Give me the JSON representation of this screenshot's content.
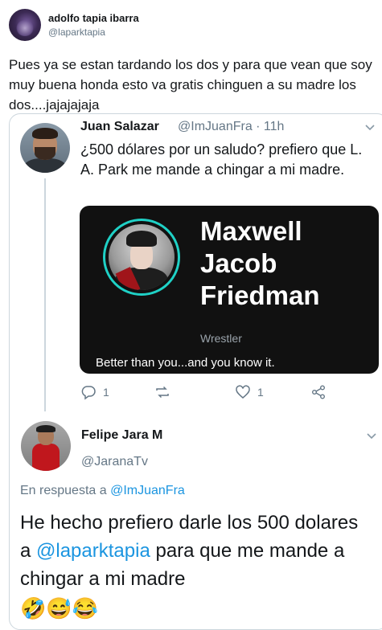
{
  "tweet": {
    "author_name": "adolfo tapia ibarra",
    "author_handle": "@laparktapia",
    "text": "Pues ya se estan tardando los dos y para que vean que soy muy buena honda esto va gratis chinguen a su madre los dos....jajajajaja"
  },
  "quoted": {
    "author_name": "Juan Salazar",
    "author_handle": "@ImJuanFra · 11h",
    "text": "¿500 dólares por un saludo? prefiero que L. A. Park me mande a chingar a mi madre.",
    "media": {
      "name": "Maxwell Jacob Friedman",
      "role": "Wrestler",
      "bio": "Better than you...and you know it.",
      "ring_color": "#1fd1c6"
    },
    "actions": {
      "reply_count": "1",
      "retweet_count": "",
      "like_count": "1"
    }
  },
  "reply": {
    "author_name": "Felipe Jara M",
    "author_handle": "@JaranaTv",
    "replying_prefix": "En respuesta a ",
    "replying_to": "@ImJuanFra",
    "text_part1": "He hecho prefiero darle los 500 dolares a ",
    "mention": "@laparktapia",
    "text_part2": " para que me mande a chingar a mi madre",
    "emojis": "🤣😅😂"
  },
  "colors": {
    "link": "#1b95e0",
    "muted": "#657786",
    "border": "#ccd6dd"
  }
}
